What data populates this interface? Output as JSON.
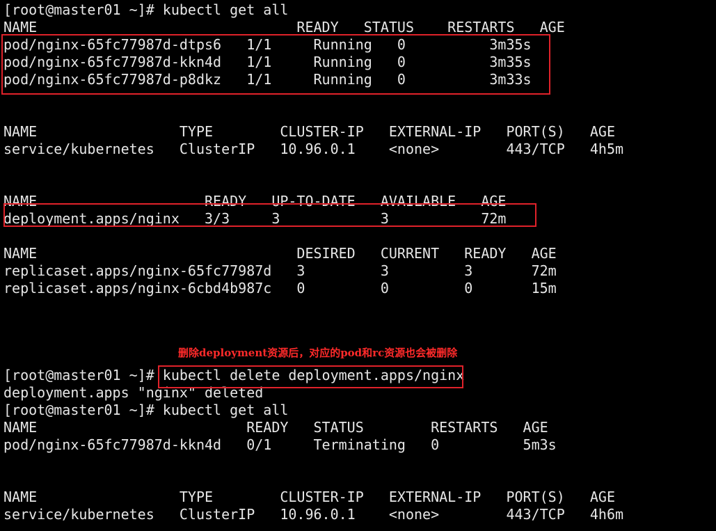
{
  "terminal": {
    "lines": [
      "[root@master01 ~]# kubectl get all",
      "NAME                               READY   STATUS    RESTARTS   AGE",
      "pod/nginx-65fc77987d-dtps6   1/1     Running   0          3m35s",
      "pod/nginx-65fc77987d-kkn4d   1/1     Running   0          3m35s",
      "pod/nginx-65fc77987d-p8dkz   1/1     Running   0          3m33s",
      "NAME                 TYPE        CLUSTER-IP   EXTERNAL-IP   PORT(S)   AGE",
      "service/kubernetes   ClusterIP   10.96.0.1    <none>        443/TCP   4h5m",
      "NAME                    READY   UP-TO-DATE   AVAILABLE   AGE",
      "deployment.apps/nginx   3/3     3            3           72m",
      "NAME                               DESIRED   CURRENT   READY   AGE",
      "replicaset.apps/nginx-65fc77987d   3         3         3       72m",
      "replicaset.apps/nginx-6cbd4b987c   0         0         0       15m",
      "[root@master01 ~]# kubectl delete deployment.apps/nginx",
      "deployment.apps \"nginx\" deleted",
      "[root@master01 ~]# kubectl get all",
      "NAME                         READY   STATUS        RESTARTS   AGE",
      "pod/nginx-65fc77987d-kkn4d   0/1     Terminating   0          5m3s",
      "NAME                 TYPE        CLUSTER-IP   EXTERNAL-IP   PORT(S)   AGE",
      "service/kubernetes   ClusterIP   10.96.0.1    <none>        443/TCP   4h6m"
    ],
    "annotation": "删除deployment资源后，对应的pod和rc资源也会被删除",
    "colors": {
      "background": "#000000",
      "text": "#e6e6e6",
      "highlight_border": "#e0222a",
      "annotation": "#ff2a2a"
    }
  }
}
